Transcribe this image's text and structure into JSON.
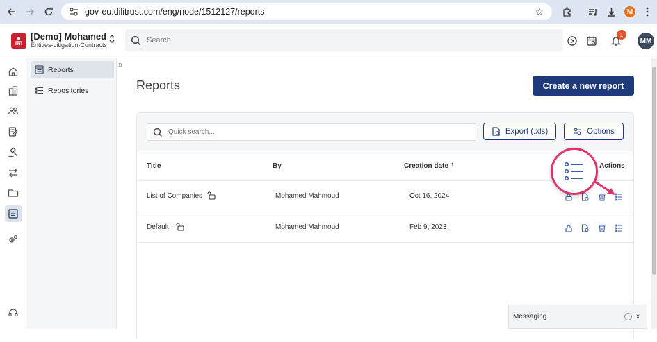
{
  "browser": {
    "url": "gov-eu.dilitrust.com/eng/node/1512127/reports",
    "profile_initial": "M"
  },
  "header": {
    "brand_name": "[Demo] Mohamed",
    "brand_sub": "Entities-Litigation-Contracts",
    "search_placeholder": "Search",
    "notification_count": "1",
    "avatar_initials": "MM"
  },
  "subnav": {
    "items": [
      {
        "label": "Reports",
        "active": true
      },
      {
        "label": "Repositories",
        "active": false
      }
    ]
  },
  "main": {
    "title": "Reports",
    "create_button": "Create a new report",
    "quick_search_placeholder": "Quick search...",
    "export_button": "Export (.xls)",
    "options_button": "Options"
  },
  "table": {
    "columns": {
      "title": "Title",
      "by": "By",
      "creation_date": "Creation date",
      "actions": "Actions"
    },
    "sort_indicator": "↑",
    "rows": [
      {
        "title": "List of Companies",
        "by": "Mohamed Mahmoud",
        "date": "Oct 16, 2024"
      },
      {
        "title": "Default",
        "by": "Mohamed Mahmoud",
        "date": "Feb 9, 2023"
      }
    ]
  },
  "messaging": {
    "label": "Messaging",
    "close": "x"
  },
  "colors": {
    "accent": "#1f3a7a",
    "highlight": "#e0336b",
    "brand": "#c8202f",
    "icon": "#3b5ba8"
  }
}
